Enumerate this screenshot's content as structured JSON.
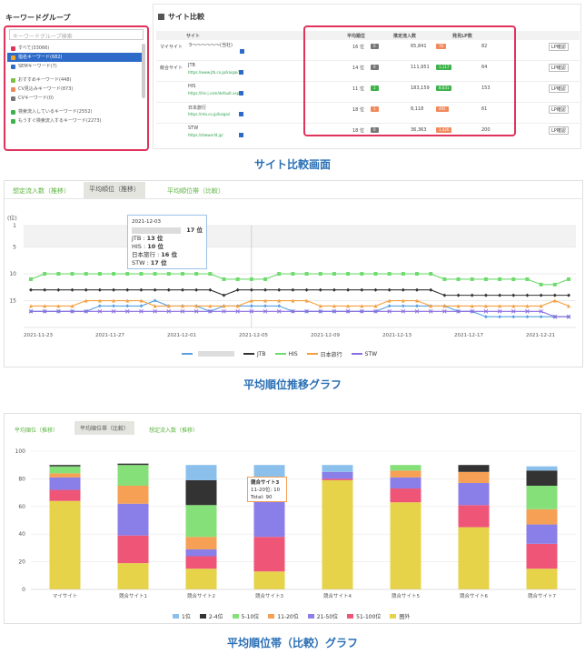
{
  "section1": {
    "keyword_group_title": "キーワードグループ",
    "site_compare_title": "サイト比較",
    "search_placeholder": "キーワードグループ検索",
    "keyword_groups": [
      {
        "label": "すべて(33066)",
        "color": "#e0325a",
        "selected": false
      },
      {
        "label": "指名キーワード(682)",
        "color": "#f5a623",
        "selected": true
      },
      {
        "label": "SEMキーワード(7)",
        "color": "#2e6bc9",
        "selected": false
      },
      {
        "label": "おすすめキーワード(448)",
        "color": "#7ac142",
        "selected": false
      },
      {
        "label": "CV見込みキーワード(873)",
        "color": "#f08a5d",
        "selected": false
      },
      {
        "label": "CVキーワード(0)",
        "color": "#777777",
        "selected": false
      },
      {
        "label": "検索流入しているキーワード(2552)",
        "color": "#3db34a",
        "selected": false
      },
      {
        "label": "もうすぐ検索流入するキーワード(2273)",
        "color": "#3db34a",
        "selected": false
      }
    ],
    "table_headers": {
      "site": "サイト",
      "avg_rank": "平均順位",
      "est_traffic": "推定流入数",
      "lp_count": "発見LP数"
    },
    "my_site_label": "マイサイト",
    "competitor_label": "競合サイト",
    "lp_button_label": "LP確認",
    "rows": [
      {
        "name": "ラ〜〜〜〜〜〜(当社)",
        "url": "",
        "rank": "16 位",
        "rank_delta": "0",
        "traffic": "65,841",
        "traffic_delta": "70",
        "delta_type": "down",
        "lp": "82"
      },
      {
        "name": "JTB",
        "url": "https://www.jtb.co.jp/kaigai/",
        "rank": "14 位",
        "rank_delta": "0",
        "traffic": "111,951",
        "traffic_delta": "1,117",
        "delta_type": "up",
        "lp": "64"
      },
      {
        "name": "HIS",
        "url": "https://his-j.com/default.aspx",
        "rank": "11 位",
        "rank_delta": "1",
        "traffic": "183,159",
        "traffic_delta": "8,631",
        "delta_type": "up",
        "lp": "153"
      },
      {
        "name": "日本旅行",
        "url": "https://nta.co.jp/kaigai/",
        "rank": "18 位",
        "rank_delta": "1",
        "traffic": "8,118",
        "traffic_delta": "492",
        "delta_type": "down",
        "lp": "61"
      },
      {
        "name": "STW",
        "url": "https://stwworld.jp/",
        "rank": "18 位",
        "rank_delta": "0",
        "traffic": "36,363",
        "traffic_delta": "1,426",
        "delta_type": "down",
        "lp": "200"
      }
    ],
    "caption": "サイト比較画面"
  },
  "section2": {
    "tabs": [
      "想定流入数（推移）",
      "平均順位（推移）",
      "平均順位帯（比較）"
    ],
    "active_tab": 1,
    "y_unit": "(位)",
    "tooltip": {
      "date": "2021-12-03",
      "lines": [
        {
          "name": "",
          "value": "17 位"
        },
        {
          "name": "JTB :",
          "value": "13 位"
        },
        {
          "name": "HIS :",
          "value": "10 位"
        },
        {
          "name": "日本旅行 :",
          "value": "16 位"
        },
        {
          "name": "STW :",
          "value": "17 位"
        }
      ]
    },
    "caption": "平均順位推移グラフ"
  },
  "section3": {
    "tabs": [
      "平均順位（推移）",
      "平均順位帯（比較）",
      "想定流入数（推移）"
    ],
    "active_tab": 1,
    "tooltip": {
      "title": "競合サイト3",
      "line1": "11-20位: 10",
      "line2": "Total: 90"
    },
    "caption": "平均順位帯（比較）グラフ"
  },
  "line_chart_data": {
    "type": "line",
    "ylim": [
      1,
      20
    ],
    "y_reversed": true,
    "yticks": [
      1,
      5,
      10,
      15
    ],
    "x_ticks": [
      "2021-11-23",
      "2021-11-27",
      "2021-12-01",
      "2021-12-05",
      "2021-12-09",
      "2021-12-13",
      "2021-12-17",
      "2021-12-21"
    ],
    "series": [
      {
        "name": "",
        "color": "#5aa0e0",
        "marker": "diamond",
        "values": [
          17,
          17,
          17,
          17,
          17,
          16,
          16,
          16,
          16,
          15,
          16,
          16,
          16,
          17,
          16,
          16,
          16,
          16,
          16,
          17,
          17,
          17,
          17,
          17,
          17,
          17,
          16,
          16,
          16,
          16,
          16,
          17,
          17,
          18,
          18,
          18,
          18,
          18,
          18,
          18
        ]
      },
      {
        "name": "JTB",
        "color": "#333333",
        "marker": "diamond",
        "values": [
          13,
          13,
          13,
          13,
          13,
          13,
          13,
          13,
          13,
          13,
          13,
          13,
          13,
          13,
          14,
          13,
          13,
          13,
          13,
          13,
          13,
          13,
          13,
          13,
          13,
          13,
          13,
          13,
          13,
          13,
          14,
          14,
          14,
          14,
          14,
          14,
          14,
          14,
          14,
          14
        ]
      },
      {
        "name": "HIS",
        "color": "#6edb6e",
        "marker": "square",
        "values": [
          11,
          10,
          10,
          10,
          10,
          10,
          10,
          10,
          10,
          10,
          10,
          10,
          10,
          10,
          11,
          11,
          11,
          11,
          10,
          10,
          10,
          10,
          10,
          10,
          10,
          10,
          10,
          10,
          10,
          10,
          11,
          11,
          11,
          11,
          11,
          11,
          11,
          12,
          12,
          11
        ]
      },
      {
        "name": "日本旅行",
        "color": "#f5a040",
        "marker": "triangle",
        "values": [
          16,
          16,
          16,
          16,
          15,
          15,
          15,
          15,
          15,
          16,
          16,
          16,
          16,
          16,
          16,
          16,
          15,
          15,
          15,
          15,
          15,
          16,
          16,
          16,
          16,
          16,
          15,
          15,
          15,
          16,
          16,
          16,
          16,
          16,
          16,
          16,
          16,
          16,
          15,
          16
        ]
      },
      {
        "name": "STW",
        "color": "#8a6ee0",
        "marker": "cross",
        "values": [
          17,
          17,
          17,
          17,
          17,
          17,
          17,
          17,
          17,
          17,
          17,
          17,
          17,
          17,
          17,
          17,
          17,
          17,
          17,
          17,
          17,
          17,
          17,
          17,
          17,
          17,
          17,
          17,
          17,
          17,
          17,
          17,
          17,
          17,
          17,
          17,
          17,
          17,
          18,
          18
        ]
      }
    ]
  },
  "bar_chart_data": {
    "type": "bar",
    "stacked": true,
    "ylim": [
      0,
      100
    ],
    "yticks": [
      0,
      20,
      40,
      60,
      80,
      100
    ],
    "categories": [
      "マイサイト",
      "競合サイト1",
      "競合サイト2",
      "競合サイト3",
      "競合サイト4",
      "競合サイト5",
      "競合サイト6",
      "競合サイト7"
    ],
    "series": [
      {
        "name": "圏外",
        "color": "#e6d34a",
        "values": [
          64,
          19,
          15,
          13,
          79,
          63,
          45,
          15
        ]
      },
      {
        "name": "51-100位",
        "color": "#ee5577",
        "values": [
          8,
          20,
          9,
          25,
          1,
          10,
          16,
          18
        ]
      },
      {
        "name": "21-50位",
        "color": "#8a7ee8",
        "values": [
          9,
          23,
          5,
          30,
          5,
          8,
          16,
          14
        ]
      },
      {
        "name": "11-20位",
        "color": "#f5a055",
        "values": [
          3,
          13,
          9,
          10,
          0,
          5,
          8,
          11
        ]
      },
      {
        "name": "5-10位",
        "color": "#86e07a",
        "values": [
          5,
          15,
          23,
          2,
          0,
          4,
          0,
          17
        ]
      },
      {
        "name": "2-4位",
        "color": "#333333",
        "values": [
          1,
          1,
          18,
          1,
          0,
          0,
          5,
          11
        ]
      },
      {
        "name": "1位",
        "color": "#8cc0ec",
        "values": [
          0,
          0,
          11,
          9,
          5,
          0,
          0,
          3
        ]
      }
    ],
    "legend_order": [
      "1位",
      "2-4位",
      "5-10位",
      "11-20位",
      "21-50位",
      "51-100位",
      "圏外"
    ]
  }
}
